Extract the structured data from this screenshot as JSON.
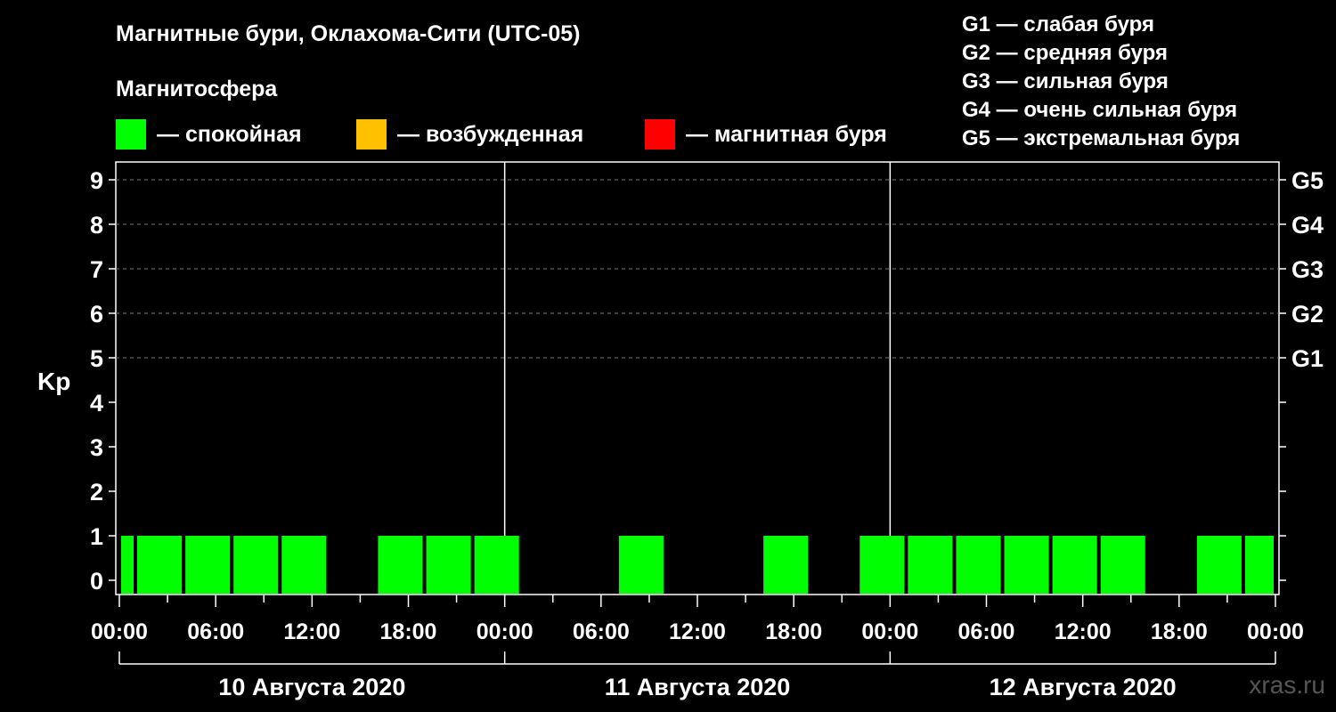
{
  "title": "Магнитные бури, Оклахома-Сити (UTC-05)",
  "subtitle": "Магнитосфера",
  "legend": [
    {
      "color": "#00ff00",
      "label": "— спокойная"
    },
    {
      "color": "#ffc000",
      "label": "— возбужденная"
    },
    {
      "color": "#ff0000",
      "label": "— магнитная буря"
    }
  ],
  "g_legend": [
    "G1 — слабая буря",
    "G2 — средняя буря",
    "G3 — сильная буря",
    "G4 — очень сильная буря",
    "G5 — экстремальная буря"
  ],
  "watermark": "xras.ru",
  "chart_data": {
    "type": "bar",
    "ylabel": "Kp",
    "ylim": [
      0,
      9
    ],
    "y_ticks": [
      "0",
      "1",
      "2",
      "3",
      "4",
      "5",
      "6",
      "7",
      "8",
      "9"
    ],
    "g_ticks": [
      {
        "kp": 5,
        "label": "G1"
      },
      {
        "kp": 6,
        "label": "G2"
      },
      {
        "kp": 7,
        "label": "G3"
      },
      {
        "kp": 8,
        "label": "G4"
      },
      {
        "kp": 9,
        "label": "G5"
      }
    ],
    "x_ticks": [
      "00:00",
      "06:00",
      "12:00",
      "18:00",
      "00:00",
      "06:00",
      "12:00",
      "18:00",
      "00:00",
      "06:00",
      "12:00",
      "18:00",
      "00:00"
    ],
    "days": [
      "10 Августа 2020",
      "11 Августа 2020",
      "12 Августа 2020"
    ],
    "interval_hours": 3,
    "start_offset_hours": -2,
    "kp_values": [
      1,
      1,
      1,
      1,
      1,
      0,
      1,
      1,
      1,
      0,
      0,
      1,
      0,
      0,
      1,
      0,
      1,
      1,
      1,
      1,
      1,
      1,
      0,
      1,
      1
    ],
    "colors": {
      "quiet": "#00ff00",
      "active": "#ffc000",
      "storm": "#ff0000"
    },
    "grid": true
  }
}
